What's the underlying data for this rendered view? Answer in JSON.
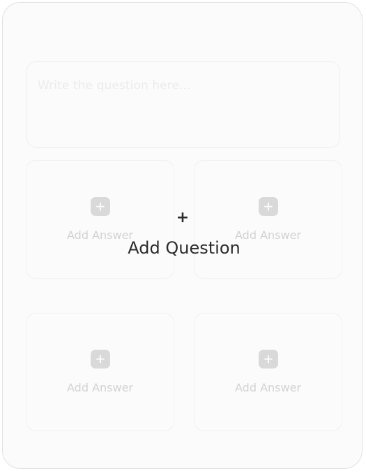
{
  "question": {
    "placeholder": "Write the question here..."
  },
  "answers": [
    {
      "label": "Add Answer",
      "icon": "plus-icon"
    },
    {
      "label": "Add Answer",
      "icon": "plus-icon"
    },
    {
      "label": "Add Answer",
      "icon": "plus-icon"
    },
    {
      "label": "Add Answer",
      "icon": "plus-icon"
    }
  ],
  "add_question": {
    "icon_glyph": "+",
    "label": "Add Question"
  },
  "colors": {
    "card_background": "#fbfbfb",
    "card_border": "#e2e2e2",
    "chip": "#d9d9d9",
    "muted_text": "#d2d2d2",
    "dark_text": "#2b2b2b"
  }
}
